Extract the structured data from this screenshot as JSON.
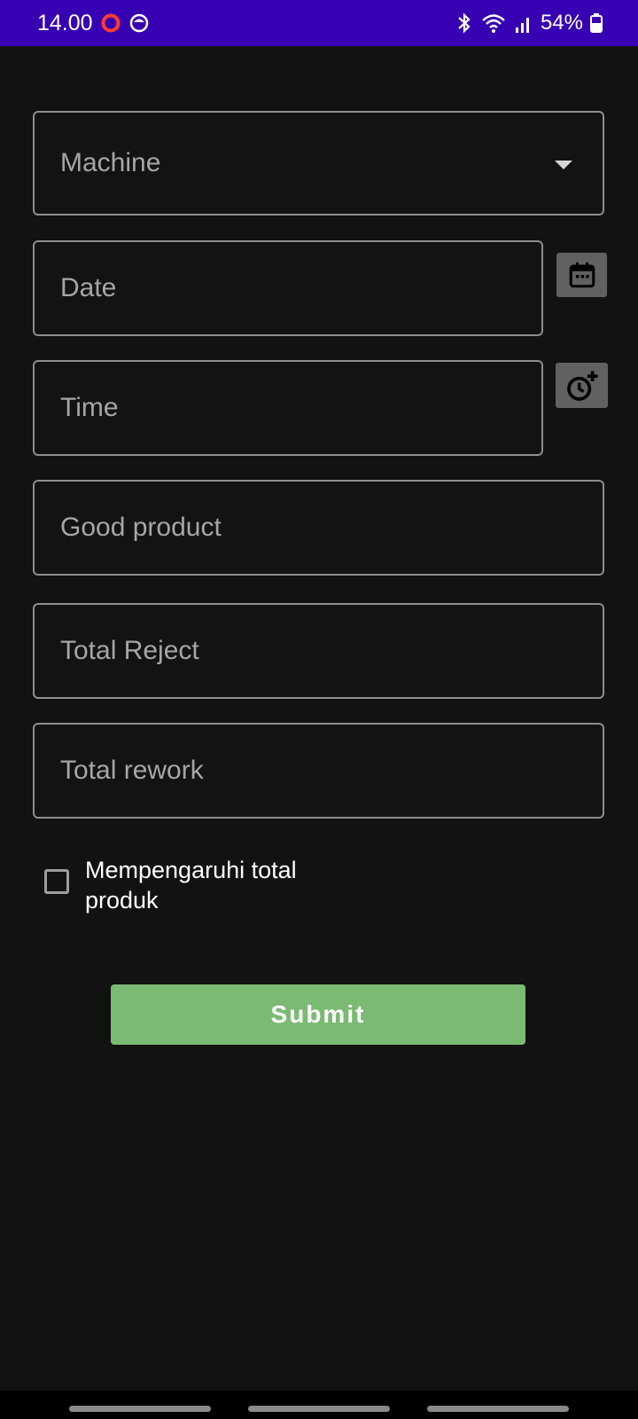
{
  "status_bar": {
    "time": "14.00",
    "battery_percent": "54%",
    "left_icons": [
      "opera-icon",
      "notification-app-icon"
    ],
    "right_icons": [
      "bluetooth-icon",
      "wifi-icon",
      "signal-icon",
      "battery-icon"
    ]
  },
  "form": {
    "machine": {
      "placeholder": "Machine",
      "icon": "dropdown-arrow-icon"
    },
    "date": {
      "placeholder": "Date",
      "icon": "calendar-icon"
    },
    "time": {
      "placeholder": "Time",
      "icon": "add-alarm-icon"
    },
    "good_product": {
      "placeholder": "Good product"
    },
    "total_reject": {
      "placeholder": "Total Reject"
    },
    "total_rework": {
      "placeholder": "Total rework"
    },
    "affects_total": {
      "label": "Mempengaruhi total produk",
      "checked": false
    },
    "submit_label": "Submit"
  },
  "colors": {
    "status_bar": "#3700b3",
    "background": "#121212",
    "field_border": "#8e8e8e",
    "submit": "#7aba72",
    "icon_button": "#616161"
  }
}
